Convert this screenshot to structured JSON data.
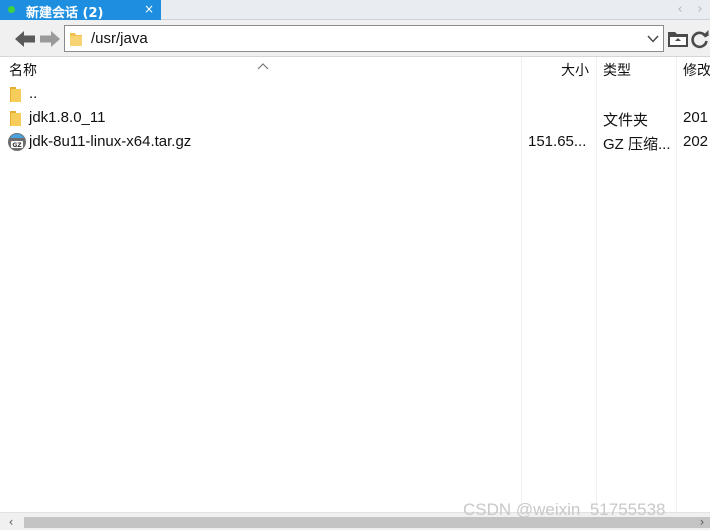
{
  "tab": {
    "label": "新建会话 (2)",
    "close": "×",
    "status_color": "#3fd13f",
    "accent": "#1e8fe0"
  },
  "tab_nav": {
    "prev": "‹",
    "next": "›"
  },
  "toolbar": {
    "path": "/usr/java",
    "icons": [
      "back-arrow-icon",
      "forward-arrow-icon",
      "folder-icon",
      "chevron-down-icon",
      "open-folder-icon",
      "refresh-icon"
    ]
  },
  "columns": {
    "name": "名称",
    "size": "大小",
    "type": "类型",
    "modified": "修改"
  },
  "files": [
    {
      "name": "..",
      "size": "",
      "type": "",
      "modified": "",
      "icon": "folder-icon"
    },
    {
      "name": "jdk1.8.0_11",
      "size": "",
      "type": "文件夹",
      "modified": "201",
      "icon": "folder-icon"
    },
    {
      "name": "jdk-8u11-linux-x64.tar.gz",
      "size": "151.65...",
      "type": "GZ 压缩...",
      "modified": "202",
      "icon": "gz-archive-icon"
    }
  ],
  "scrollbar": {
    "left": "‹",
    "right": "›"
  },
  "watermark": "CSDN @weixin_51755538"
}
